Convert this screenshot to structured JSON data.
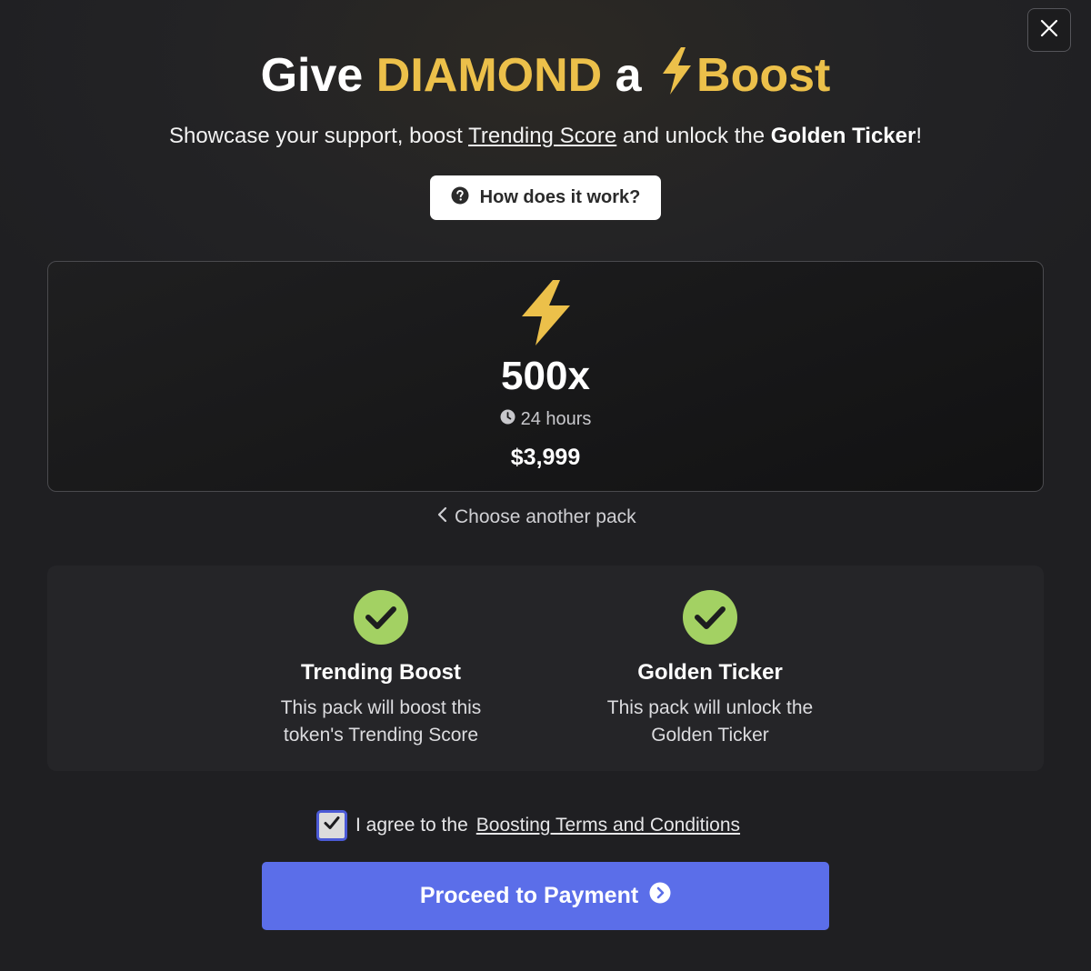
{
  "modal": {
    "close_icon": "close-icon",
    "title": {
      "prefix": "Give",
      "token": "DIAMOND",
      "middle": "a",
      "boost_icon": "lightning-bolt-icon",
      "boost_word": "Boost"
    },
    "subtitle": {
      "part1": "Showcase your support, boost",
      "trending_link": "Trending Score",
      "part2": "and unlock the",
      "golden_ticker": "Golden Ticker",
      "end": "!"
    },
    "how_button": {
      "icon": "question-circle-icon",
      "label": "How does it work?"
    }
  },
  "pack": {
    "icon": "lightning-bolt-icon",
    "multiplier": "500x",
    "duration_icon": "clock-icon",
    "duration": "24 hours",
    "price": "$3,999",
    "choose_another_icon": "chevron-left-icon",
    "choose_another": "Choose another pack"
  },
  "features": [
    {
      "icon": "check-circle-icon",
      "title": "Trending Boost",
      "desc_line1": "This pack will boost this",
      "desc_line2": "token's Trending Score"
    },
    {
      "icon": "check-circle-icon",
      "title": "Golden Ticker",
      "desc_line1": "This pack will unlock the",
      "desc_line2": "Golden Ticker"
    }
  ],
  "agreement": {
    "checked": true,
    "text": "I agree to the",
    "link": "Boosting Terms and Conditions"
  },
  "proceed_button": {
    "label": "Proceed to Payment",
    "icon": "arrow-right-circle-icon"
  },
  "colors": {
    "gold": "#ecc04a",
    "accent": "#5b6ee9",
    "check_green": "#a3d163"
  }
}
